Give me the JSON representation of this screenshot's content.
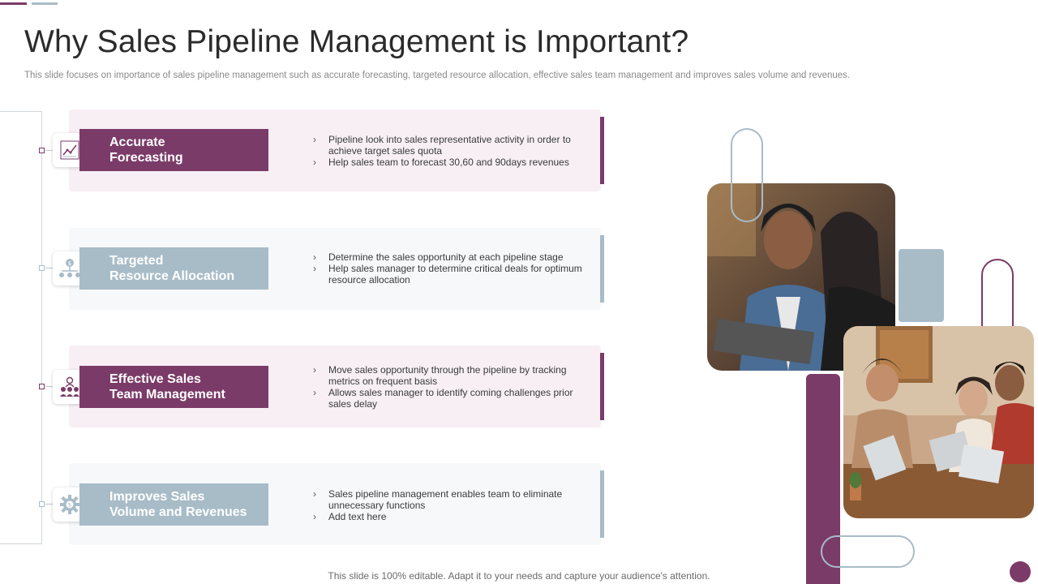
{
  "title": "Why Sales Pipeline Management is Important?",
  "subtitle": "This slide focuses on importance of sales pipeline management such as accurate forecasting, targeted resource allocation, effective sales team management and improves sales volume and revenues.",
  "items": [
    {
      "label": "Accurate\nForecasting",
      "icon": "forecast-chart-icon",
      "bullets": [
        "Pipeline look into sales representative activity in order to achieve target sales quota",
        "Help sales team to forecast 30,60 and 90days revenues"
      ]
    },
    {
      "label": "Targeted\nResource Allocation",
      "icon": "resource-allocation-icon",
      "bullets": [
        "Determine the sales opportunity at each pipeline stage",
        "Help sales manager to determine critical deals for optimum resource allocation"
      ]
    },
    {
      "label": "Effective Sales\nTeam Management",
      "icon": "team-management-icon",
      "bullets": [
        "Move  sales opportunity through the pipeline by tracking metrics on frequent basis",
        "Allows sales manager to identify coming challenges prior sales delay"
      ]
    },
    {
      "label": "Improves Sales\nVolume and Revenues",
      "icon": "revenue-gear-icon",
      "bullets": [
        "Sales pipeline management enables team to eliminate unnecessary functions",
        "Add text here"
      ]
    }
  ],
  "footer": "This slide is 100% editable. Adapt it to your needs and capture your audience's attention.",
  "colors": {
    "purple": "#7b3b68",
    "blue": "#a8bcc8",
    "purple_tint": "#f7eff4",
    "blue_tint": "#f6f8fa"
  }
}
